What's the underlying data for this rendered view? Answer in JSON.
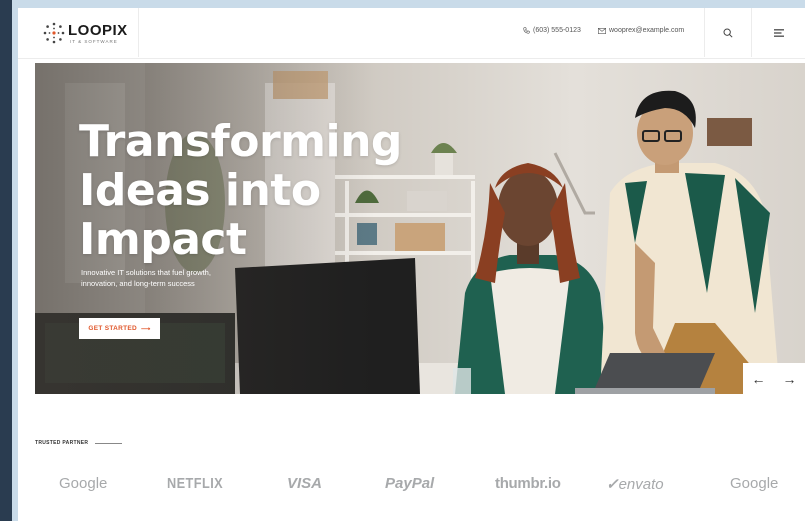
{
  "brand": {
    "name": "LOOPIX",
    "tagline": "IT & SOFTWARE"
  },
  "header": {
    "phone": "(603) 555-0123",
    "email": "wooprex@example.com",
    "search_icon": "search-icon",
    "menu_icon": "menu-icon"
  },
  "hero": {
    "title_line1": "Transforming",
    "title_line2": "Ideas into",
    "title_line3": "Impact",
    "subtitle_line1": "Innovative IT solutions that fuel growth,",
    "subtitle_line2": "innovation, and long-term success",
    "cta_label": "GET STARTED",
    "cta_arrow": "⟶",
    "prev_arrow": "←",
    "next_arrow": "→"
  },
  "partners": {
    "label": "TRUSTED PARTNER",
    "logos": [
      "Google",
      "NETFLIX",
      "VISA",
      "PayPal",
      "thumbr.io",
      "envato",
      "Google"
    ]
  },
  "colors": {
    "accent": "#e0572b",
    "frame": "#2a3c50",
    "background": "#c9dbe9"
  }
}
